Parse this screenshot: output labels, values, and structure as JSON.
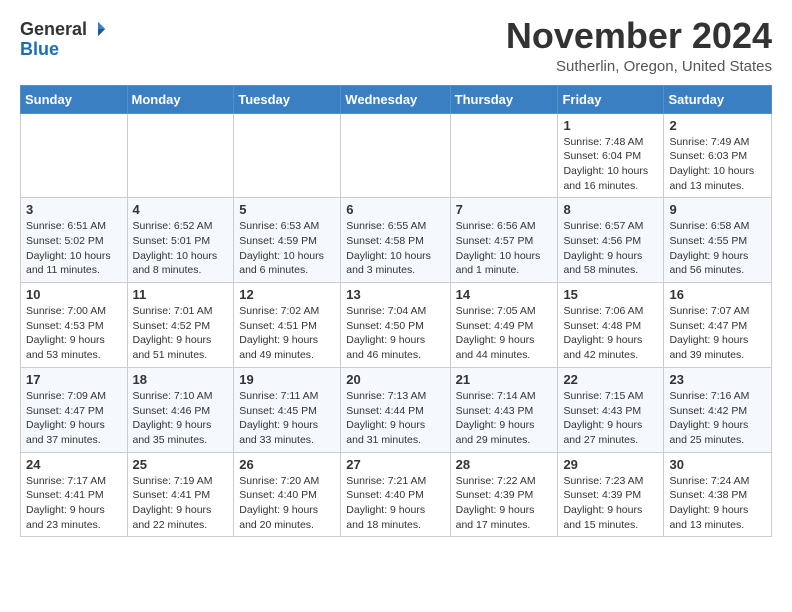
{
  "header": {
    "logo_general": "General",
    "logo_blue": "Blue",
    "month_title": "November 2024",
    "subtitle": "Sutherlin, Oregon, United States"
  },
  "weekdays": [
    "Sunday",
    "Monday",
    "Tuesday",
    "Wednesday",
    "Thursday",
    "Friday",
    "Saturday"
  ],
  "weeks": [
    [
      {
        "day": "",
        "info": ""
      },
      {
        "day": "",
        "info": ""
      },
      {
        "day": "",
        "info": ""
      },
      {
        "day": "",
        "info": ""
      },
      {
        "day": "",
        "info": ""
      },
      {
        "day": "1",
        "info": "Sunrise: 7:48 AM\nSunset: 6:04 PM\nDaylight: 10 hours and 16 minutes."
      },
      {
        "day": "2",
        "info": "Sunrise: 7:49 AM\nSunset: 6:03 PM\nDaylight: 10 hours and 13 minutes."
      }
    ],
    [
      {
        "day": "3",
        "info": "Sunrise: 6:51 AM\nSunset: 5:02 PM\nDaylight: 10 hours and 11 minutes."
      },
      {
        "day": "4",
        "info": "Sunrise: 6:52 AM\nSunset: 5:01 PM\nDaylight: 10 hours and 8 minutes."
      },
      {
        "day": "5",
        "info": "Sunrise: 6:53 AM\nSunset: 4:59 PM\nDaylight: 10 hours and 6 minutes."
      },
      {
        "day": "6",
        "info": "Sunrise: 6:55 AM\nSunset: 4:58 PM\nDaylight: 10 hours and 3 minutes."
      },
      {
        "day": "7",
        "info": "Sunrise: 6:56 AM\nSunset: 4:57 PM\nDaylight: 10 hours and 1 minute."
      },
      {
        "day": "8",
        "info": "Sunrise: 6:57 AM\nSunset: 4:56 PM\nDaylight: 9 hours and 58 minutes."
      },
      {
        "day": "9",
        "info": "Sunrise: 6:58 AM\nSunset: 4:55 PM\nDaylight: 9 hours and 56 minutes."
      }
    ],
    [
      {
        "day": "10",
        "info": "Sunrise: 7:00 AM\nSunset: 4:53 PM\nDaylight: 9 hours and 53 minutes."
      },
      {
        "day": "11",
        "info": "Sunrise: 7:01 AM\nSunset: 4:52 PM\nDaylight: 9 hours and 51 minutes."
      },
      {
        "day": "12",
        "info": "Sunrise: 7:02 AM\nSunset: 4:51 PM\nDaylight: 9 hours and 49 minutes."
      },
      {
        "day": "13",
        "info": "Sunrise: 7:04 AM\nSunset: 4:50 PM\nDaylight: 9 hours and 46 minutes."
      },
      {
        "day": "14",
        "info": "Sunrise: 7:05 AM\nSunset: 4:49 PM\nDaylight: 9 hours and 44 minutes."
      },
      {
        "day": "15",
        "info": "Sunrise: 7:06 AM\nSunset: 4:48 PM\nDaylight: 9 hours and 42 minutes."
      },
      {
        "day": "16",
        "info": "Sunrise: 7:07 AM\nSunset: 4:47 PM\nDaylight: 9 hours and 39 minutes."
      }
    ],
    [
      {
        "day": "17",
        "info": "Sunrise: 7:09 AM\nSunset: 4:47 PM\nDaylight: 9 hours and 37 minutes."
      },
      {
        "day": "18",
        "info": "Sunrise: 7:10 AM\nSunset: 4:46 PM\nDaylight: 9 hours and 35 minutes."
      },
      {
        "day": "19",
        "info": "Sunrise: 7:11 AM\nSunset: 4:45 PM\nDaylight: 9 hours and 33 minutes."
      },
      {
        "day": "20",
        "info": "Sunrise: 7:13 AM\nSunset: 4:44 PM\nDaylight: 9 hours and 31 minutes."
      },
      {
        "day": "21",
        "info": "Sunrise: 7:14 AM\nSunset: 4:43 PM\nDaylight: 9 hours and 29 minutes."
      },
      {
        "day": "22",
        "info": "Sunrise: 7:15 AM\nSunset: 4:43 PM\nDaylight: 9 hours and 27 minutes."
      },
      {
        "day": "23",
        "info": "Sunrise: 7:16 AM\nSunset: 4:42 PM\nDaylight: 9 hours and 25 minutes."
      }
    ],
    [
      {
        "day": "24",
        "info": "Sunrise: 7:17 AM\nSunset: 4:41 PM\nDaylight: 9 hours and 23 minutes."
      },
      {
        "day": "25",
        "info": "Sunrise: 7:19 AM\nSunset: 4:41 PM\nDaylight: 9 hours and 22 minutes."
      },
      {
        "day": "26",
        "info": "Sunrise: 7:20 AM\nSunset: 4:40 PM\nDaylight: 9 hours and 20 minutes."
      },
      {
        "day": "27",
        "info": "Sunrise: 7:21 AM\nSunset: 4:40 PM\nDaylight: 9 hours and 18 minutes."
      },
      {
        "day": "28",
        "info": "Sunrise: 7:22 AM\nSunset: 4:39 PM\nDaylight: 9 hours and 17 minutes."
      },
      {
        "day": "29",
        "info": "Sunrise: 7:23 AM\nSunset: 4:39 PM\nDaylight: 9 hours and 15 minutes."
      },
      {
        "day": "30",
        "info": "Sunrise: 7:24 AM\nSunset: 4:38 PM\nDaylight: 9 hours and 13 minutes."
      }
    ]
  ]
}
